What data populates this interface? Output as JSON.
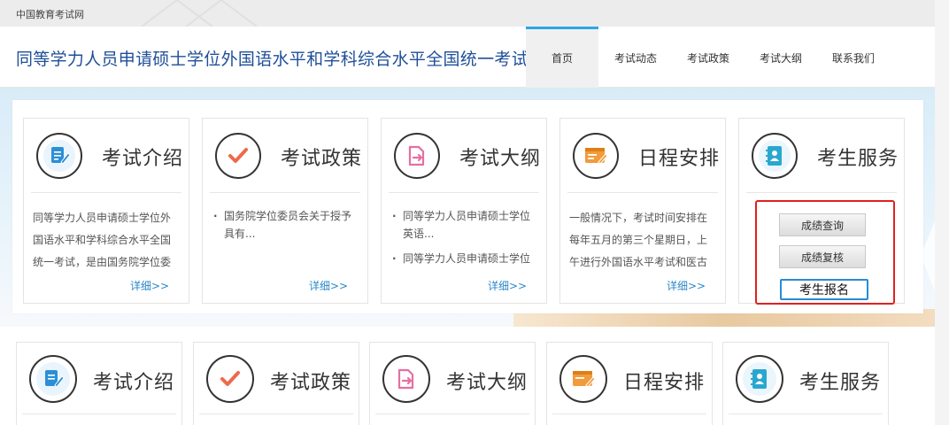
{
  "site_name": "中国教育考试网",
  "header": {
    "title": "同等学力人员申请硕士学位外国语水平和学科综合水平全国统一考试",
    "nav": [
      {
        "label": "首页",
        "active": true
      },
      {
        "label": "考试动态",
        "active": false
      },
      {
        "label": "考试政策",
        "active": false
      },
      {
        "label": "考试大纲",
        "active": false
      },
      {
        "label": "联系我们",
        "active": false
      }
    ]
  },
  "cards": [
    {
      "title": "考试介绍",
      "icon": "document-edit-icon",
      "color": "#2c8fd6",
      "text": "同等学力人员申请硕士学位外国语水平和学科综合水平全国统一考试，是由国务院学位委",
      "more": "详细>>"
    },
    {
      "title": "考试政策",
      "icon": "checkmark-icon",
      "color": "#ee6a4c",
      "items": [
        "国务院学位委员会关于授予具有..."
      ],
      "more": "详细>>"
    },
    {
      "title": "考试大纲",
      "icon": "file-export-icon",
      "color": "#e66fa2",
      "items": [
        "同等学力人员申请硕士学位英语...",
        "同等学力人员申请硕士学位"
      ],
      "more": "详细>>"
    },
    {
      "title": "日程安排",
      "icon": "schedule-icon",
      "color": "#f29b3c",
      "text": "一般情况下，考试时间安排在每年五月的第三个星期日，上午进行外国语水平考试和医古",
      "more": "详细>>"
    },
    {
      "title": "考生服务",
      "icon": "contact-book-icon",
      "color": "#2aa7cf",
      "buttons": {
        "score_query": "成绩查询",
        "score_review": "成绩复核",
        "register": "考生报名"
      }
    }
  ],
  "row2": [
    {
      "title": "考试介绍",
      "icon": "document-edit-icon"
    },
    {
      "title": "考试政策",
      "icon": "checkmark-icon"
    },
    {
      "title": "考试大纲",
      "icon": "file-export-icon"
    },
    {
      "title": "日程安排",
      "icon": "schedule-icon"
    },
    {
      "title": "考生服务",
      "icon": "contact-book-icon"
    }
  ]
}
